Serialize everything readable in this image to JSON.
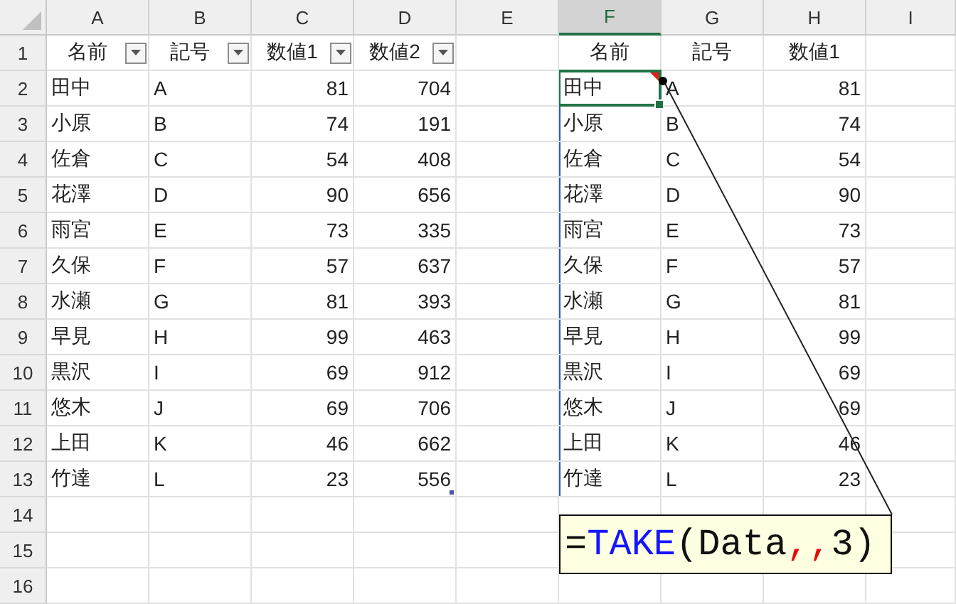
{
  "column_headers": [
    {
      "label": "A",
      "selected": false
    },
    {
      "label": "B",
      "selected": false
    },
    {
      "label": "C",
      "selected": false
    },
    {
      "label": "D",
      "selected": false
    },
    {
      "label": "E",
      "selected": false
    },
    {
      "label": "F",
      "selected": true
    },
    {
      "label": "G",
      "selected": false
    },
    {
      "label": "H",
      "selected": false
    },
    {
      "label": "I",
      "selected": false
    }
  ],
  "row_headers": [
    "1",
    "2",
    "3",
    "4",
    "5",
    "6",
    "7",
    "8",
    "9",
    "10",
    "11",
    "12",
    "13",
    "14",
    "15",
    "16"
  ],
  "source_table": {
    "columns": [
      {
        "label": "名前",
        "kind": "text",
        "filter": true
      },
      {
        "label": "記号",
        "kind": "text",
        "filter": true
      },
      {
        "label": "数値1",
        "kind": "number",
        "filter": true
      },
      {
        "label": "数値2",
        "kind": "number",
        "filter": true
      }
    ],
    "rows": [
      [
        "田中",
        "A",
        "81",
        "704"
      ],
      [
        "小原",
        "B",
        "74",
        "191"
      ],
      [
        "佐倉",
        "C",
        "54",
        "408"
      ],
      [
        "花澤",
        "D",
        "90",
        "656"
      ],
      [
        "雨宮",
        "E",
        "73",
        "335"
      ],
      [
        "久保",
        "F",
        "57",
        "637"
      ],
      [
        "水瀬",
        "G",
        "81",
        "393"
      ],
      [
        "早見",
        "H",
        "99",
        "463"
      ],
      [
        "黒沢",
        "I",
        "69",
        "912"
      ],
      [
        "悠木",
        "J",
        "69",
        "706"
      ],
      [
        "上田",
        "K",
        "46",
        "662"
      ],
      [
        "竹達",
        "L",
        "23",
        "556"
      ]
    ]
  },
  "spill_range": {
    "columns": [
      {
        "label": "名前",
        "kind": "text"
      },
      {
        "label": "記号",
        "kind": "text"
      },
      {
        "label": "数値1",
        "kind": "number"
      }
    ],
    "rows": [
      {
        "cells": [
          "田中",
          "A",
          "81"
        ],
        "selected": true,
        "comment": true
      },
      {
        "cells": [
          "小原",
          "B",
          "74"
        ],
        "selected": false,
        "comment": false
      },
      {
        "cells": [
          "佐倉",
          "C",
          "54"
        ],
        "selected": false,
        "comment": false
      },
      {
        "cells": [
          "花澤",
          "D",
          "90"
        ],
        "selected": false,
        "comment": false
      },
      {
        "cells": [
          "雨宮",
          "E",
          "73"
        ],
        "selected": false,
        "comment": false
      },
      {
        "cells": [
          "久保",
          "F",
          "57"
        ],
        "selected": false,
        "comment": false
      },
      {
        "cells": [
          "水瀬",
          "G",
          "81"
        ],
        "selected": false,
        "comment": false
      },
      {
        "cells": [
          "早見",
          "H",
          "99"
        ],
        "selected": false,
        "comment": false
      },
      {
        "cells": [
          "黒沢",
          "I",
          "69"
        ],
        "selected": false,
        "comment": false
      },
      {
        "cells": [
          "悠木",
          "J",
          "69"
        ],
        "selected": false,
        "comment": false
      },
      {
        "cells": [
          "上田",
          "K",
          "46"
        ],
        "selected": false,
        "comment": false
      },
      {
        "cells": [
          "竹達",
          "L",
          "23"
        ],
        "selected": false,
        "comment": false
      }
    ]
  },
  "formula_callout": {
    "tokens": [
      {
        "text": "=",
        "kind": "plain"
      },
      {
        "text": "TAKE",
        "kind": "function"
      },
      {
        "text": "(Data",
        "kind": "plain"
      },
      {
        "text": ",,",
        "kind": "separator"
      },
      {
        "text": "3)",
        "kind": "plain"
      }
    ]
  }
}
